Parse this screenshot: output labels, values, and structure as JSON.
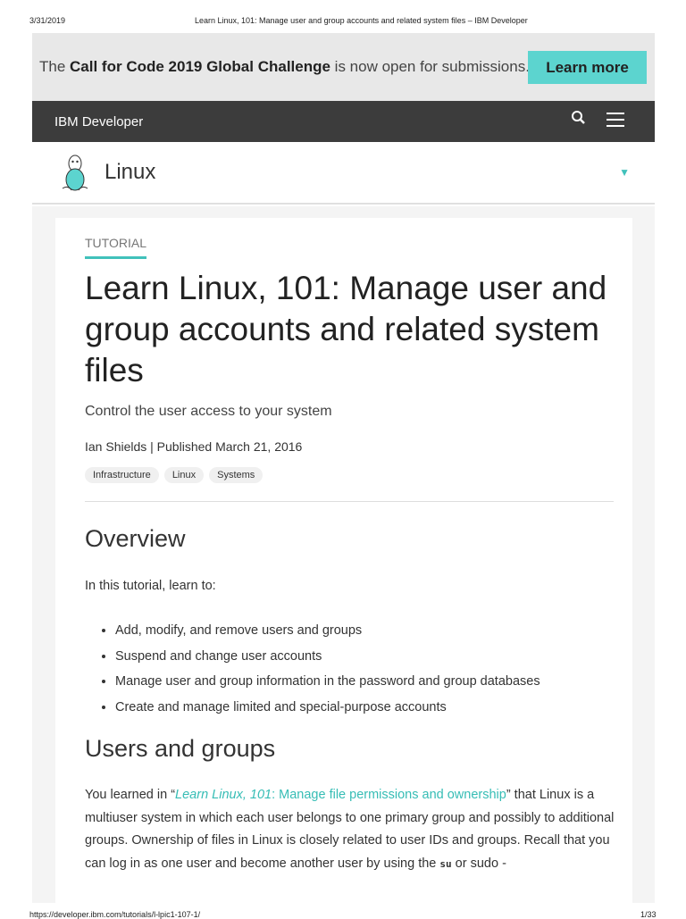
{
  "print_header": {
    "date": "3/31/2019",
    "title": "Learn Linux, 101: Manage user and group accounts and related system files – IBM Developer"
  },
  "banner": {
    "pre": "The ",
    "bold": "Call for Code 2019 Global Challenge",
    "post": " is now open for submissions.",
    "button": "Learn more"
  },
  "nav": {
    "brand_pre": "IBM ",
    "brand": "Developer",
    "search_icon": "search-icon",
    "menu_icon": "hamburger-icon"
  },
  "subnav": {
    "title": "Linux",
    "icon": "tux-penguin-icon"
  },
  "article": {
    "kicker": "TUTORIAL",
    "title": "Learn Linux, 101: Manage user and group accounts and related system files",
    "subtitle": "Control the user access to your system",
    "byline": "Ian Shields | Published March 21, 2016",
    "tags": [
      "Infrastructure",
      "Linux",
      "Systems"
    ],
    "overview_heading": "Overview",
    "intro": "In this tutorial, learn to:",
    "bullets": [
      "Add, modify, and remove users and groups",
      "Suspend and change user accounts",
      "Manage user and group information in the password and group databases",
      "Create and manage limited and special-purpose accounts"
    ],
    "users_heading": "Users and groups",
    "para_pre": "You learned in “",
    "link_italic": "Learn Linux, 101",
    "link_rest": ": Manage file permissions and ownership",
    "para_mid": "” that Linux is a multiuser system in which each user belongs to one primary group and possibly to additional groups. Ownership of files in Linux is closely related to user IDs and groups. Recall that you can log in as one user and become another user by using the ",
    "code": "su",
    "para_post": " or sudo -"
  },
  "print_footer": {
    "url": "https://developer.ibm.com/tutorials/l-lpic1-107-1/",
    "page": "1/33"
  }
}
